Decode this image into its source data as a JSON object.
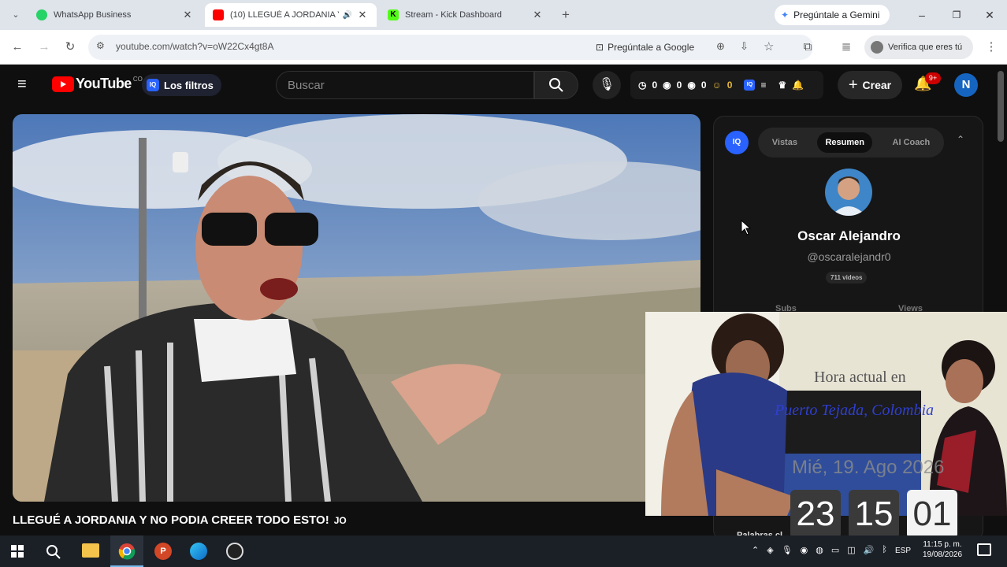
{
  "browser": {
    "tabs": [
      {
        "label": "WhatsApp Business",
        "color": "#25d366"
      },
      {
        "label": "(10) LLEGUÉ A JORDANIA Y",
        "color": "#ff0000"
      },
      {
        "label": "Stream - Kick Dashboard",
        "color": "#53fc18"
      }
    ],
    "gemini_button": "Pregúntale a Gemini",
    "url": "youtube.com/watch?v=oW22Cx4gt8A",
    "ask_google": "Pregúntale a Google",
    "verify": "Verifica que eres tú"
  },
  "youtube": {
    "logo_text": "YouTube",
    "country": "CO",
    "filters_button": "Los filtros",
    "search_placeholder": "Buscar",
    "stats": [
      "0",
      "0",
      "0",
      "0"
    ],
    "create_button": "Crear",
    "notifications_badge": "9+",
    "avatar_letter": "N",
    "video_title": "LLEGUÉ A JORDANIA Y NO PODIA CREER TODO ESTO!",
    "video_title_suffix": "JO"
  },
  "panel": {
    "tabs": [
      "Vistas",
      "Resumen",
      "AI Coach"
    ],
    "active_tab": "Resumen",
    "channel_name": "Oscar Alejandro",
    "handle": "@oscaralejandr0",
    "videos": "711 videos",
    "stat_labels": [
      "Subs",
      "Views"
    ],
    "footer_label": "Palabras cl"
  },
  "overlay": {
    "clock_title": "Hora actual en",
    "location": "Puerto Tejada, Colombia",
    "date": "Mié, 19. Ago 2026",
    "hours": "23",
    "minutes": "15",
    "seconds": "01"
  },
  "taskbar": {
    "lang": "ESP",
    "time": "11:15 p. m.",
    "date": "19/08/2026"
  },
  "colors": {
    "yt_red": "#ff0000",
    "yt_blue": "#3ea6ff",
    "iq_blue": "#2962ff"
  }
}
